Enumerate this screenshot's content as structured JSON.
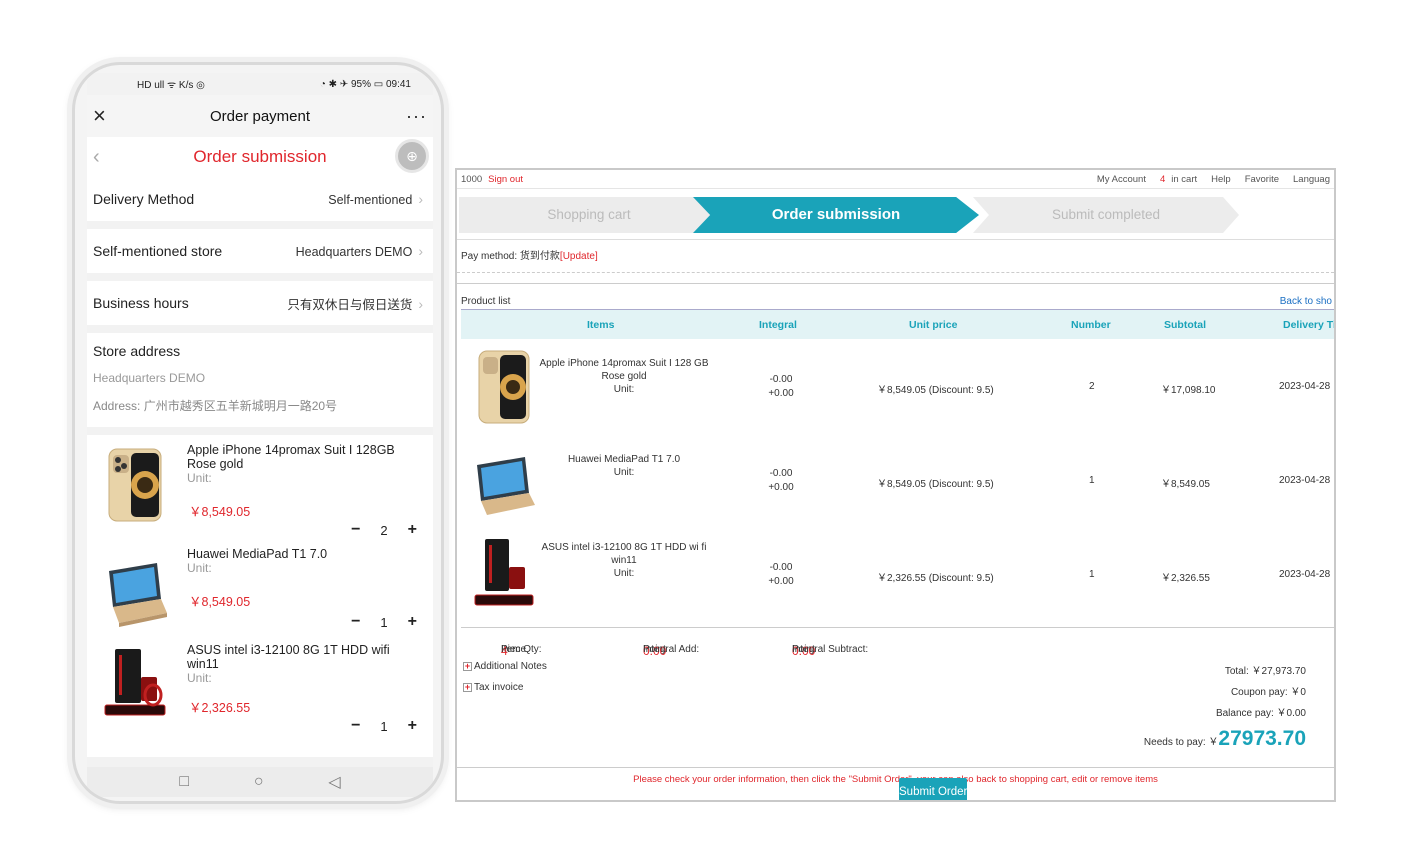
{
  "mobile": {
    "status": {
      "left": "HD ull ᯤ K/s ◎",
      "right": "◔ ✱ ✈ 95% ▭ 09:41"
    },
    "title": "Order payment",
    "close_icon": "×",
    "more_icon": "···",
    "subtitle": "Order submission",
    "back_icon": "‹",
    "globe_icon": "⊕",
    "rows": [
      {
        "label": "Delivery Method",
        "value": "Self-mentioned"
      },
      {
        "label": "Self-mentioned store",
        "value": "Headquarters DEMO"
      },
      {
        "label": "Business hours",
        "value": "只有双休日与假日送货"
      }
    ],
    "chevron": "›",
    "store": {
      "heading": "Store address",
      "name": "Headquarters DEMO",
      "address": "Address: 广州市越秀区五羊新城明月一路20号"
    },
    "products": [
      {
        "name": "Apple iPhone 14promax Suit I 128GB Rose gold",
        "unit": "Unit:",
        "price": "￥8,549.05",
        "qty": "2"
      },
      {
        "name": "Huawei MediaPad T1 7.0",
        "unit": "Unit:",
        "price": "￥8,549.05",
        "qty": "1"
      },
      {
        "name": "ASUS intel i3-12100 8G 1T HDD wifi win11",
        "unit": "Unit:",
        "price": "￥2,326.55",
        "qty": "1"
      }
    ],
    "minus": "−",
    "plus": "+",
    "nav": {
      "square": "□",
      "circle": "○",
      "back": "◁"
    }
  },
  "desktop": {
    "topbar": {
      "user": "1000",
      "sign_out": "Sign out",
      "account": "My Account",
      "cart_count": "4",
      "cart": "in cart",
      "help": "Help",
      "favorite": "Favorite",
      "language": "Languag"
    },
    "steps": [
      "Shopping cart",
      "Order submission",
      "Submit completed"
    ],
    "pay_method_label": "Pay method: 货到付款",
    "pay_method_update": "[Update]",
    "product_list": "Product list",
    "back_link": "Back to sho",
    "columns": [
      "Items",
      "Integral",
      "Unit price",
      "Number",
      "Subtotal",
      "Delivery Ti"
    ],
    "rows": [
      {
        "name": "Apple iPhone 14promax Suit I 128 GB Rose gold",
        "unit": "Unit:",
        "integral_minus": "-0.00",
        "integral_plus": "+0.00",
        "unit_price": "￥8,549.05 (Discount: 9.5)",
        "number": "2",
        "subtotal": "￥17,098.10",
        "date": "2023-04-28"
      },
      {
        "name": "Huawei MediaPad T1 7.0",
        "unit": "Unit:",
        "integral_minus": "-0.00",
        "integral_plus": "+0.00",
        "unit_price": "￥8,549.05 (Discount: 9.5)",
        "number": "1",
        "subtotal": "￥8,549.05",
        "date": "2023-04-28"
      },
      {
        "name": "ASUS intel i3-12100 8G 1T HDD wi fi win11",
        "unit": "Unit:",
        "integral_minus": "-0.00",
        "integral_plus": "+0.00",
        "unit_price": "￥2,326.55 (Discount: 9.5)",
        "number": "1",
        "subtotal": "￥2,326.55",
        "date": "2023-04-28"
      }
    ],
    "summary": {
      "qty_label": "Item Qty:",
      "qty": "4",
      "qty_unit": "Piece",
      "add_label": "Integral Add:",
      "add": "0.00",
      "add_unit": "Point",
      "sub_label": "Integral Subtract:",
      "sub": "0.00",
      "sub_unit": "Point"
    },
    "additional_notes": "Additional Notes",
    "tax_invoice": "Tax invoice",
    "plus_icon": "+",
    "totals": {
      "total": "Total: ￥27,973.70",
      "coupon": "Coupon pay: ￥0",
      "balance": "Balance pay: ￥0.00",
      "needs_label": "Needs to pay: ￥",
      "needs": "27973.70"
    },
    "notice": "Please check your order information, then click the \"Submit Order\", your can also back to shopping cart, edit or remove items",
    "submit": "Submit Order"
  }
}
